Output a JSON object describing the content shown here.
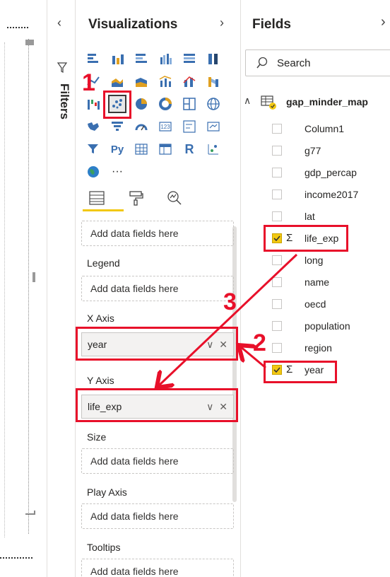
{
  "filters": {
    "label": "Filters"
  },
  "visualizations": {
    "title": "Visualizations",
    "wells": [
      {
        "label": "",
        "placeholder": "Add data fields here"
      },
      {
        "label": "Legend",
        "placeholder": "Add data fields here"
      },
      {
        "label": "X Axis",
        "value": "year"
      },
      {
        "label": "Y Axis",
        "value": "life_exp"
      },
      {
        "label": "Size",
        "placeholder": "Add data fields here"
      },
      {
        "label": "Play Axis",
        "placeholder": "Add data fields here"
      },
      {
        "label": "Tooltips",
        "placeholder": "Add data fields here"
      }
    ],
    "more_glyph": "···",
    "icon_py": "Py",
    "icon_r": "R",
    "icon_123": "123"
  },
  "fields": {
    "title": "Fields",
    "search_placeholder": "Search",
    "table_name": "gap_minder_map",
    "items": [
      {
        "name": "Column1",
        "checked": false,
        "sigma": false
      },
      {
        "name": "g77",
        "checked": false,
        "sigma": false
      },
      {
        "name": "gdp_percap",
        "checked": false,
        "sigma": false
      },
      {
        "name": "income2017",
        "checked": false,
        "sigma": false
      },
      {
        "name": "lat",
        "checked": false,
        "sigma": false
      },
      {
        "name": "life_exp",
        "checked": true,
        "sigma": true
      },
      {
        "name": "long",
        "checked": false,
        "sigma": false
      },
      {
        "name": "name",
        "checked": false,
        "sigma": false
      },
      {
        "name": "oecd",
        "checked": false,
        "sigma": false
      },
      {
        "name": "population",
        "checked": false,
        "sigma": false
      },
      {
        "name": "region",
        "checked": false,
        "sigma": false
      },
      {
        "name": "year",
        "checked": true,
        "sigma": true
      }
    ],
    "sigma_glyph": "Σ"
  },
  "annotations": {
    "step1": "1",
    "step2": "2",
    "step3": "3"
  },
  "colors": {
    "accent": "#f2c811",
    "annotation": "#e8102a"
  }
}
